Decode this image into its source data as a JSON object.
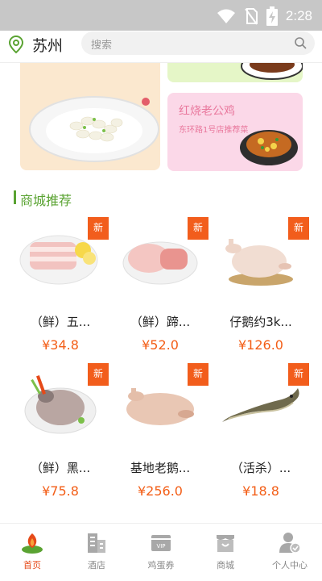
{
  "status_bar": {
    "time": "2:28"
  },
  "header": {
    "city": "苏州",
    "search_placeholder": "搜索"
  },
  "banners": {
    "title": "红烧老公鸡",
    "subtitle": "东环路1号店推荐菜"
  },
  "section": {
    "title": "商城推荐"
  },
  "products": [
    {
      "name": "（鲜）五...",
      "price": "¥34.8",
      "badge": "新"
    },
    {
      "name": "（鲜）蹄...",
      "price": "¥52.0",
      "badge": "新"
    },
    {
      "name": "仔鹅约3k...",
      "price": "¥126.0",
      "badge": "新"
    },
    {
      "name": "（鲜）黑...",
      "price": "¥75.8",
      "badge": "新"
    },
    {
      "name": "基地老鹅...",
      "price": "¥256.0",
      "badge": "新"
    },
    {
      "name": "（活杀）...",
      "price": "¥18.8",
      "badge": "新"
    }
  ],
  "nav": [
    {
      "label": "首页",
      "icon": "home-icon",
      "active": true
    },
    {
      "label": "酒店",
      "icon": "hotel-icon"
    },
    {
      "label": "鸡蛋券",
      "icon": "voucher-icon"
    },
    {
      "label": "商城",
      "icon": "store-icon"
    },
    {
      "label": "个人中心",
      "icon": "user-icon"
    }
  ],
  "colors": {
    "accent": "#5aa332",
    "price": "#f35e17",
    "badge": "#f25d1c",
    "active_nav": "#e64a19"
  }
}
